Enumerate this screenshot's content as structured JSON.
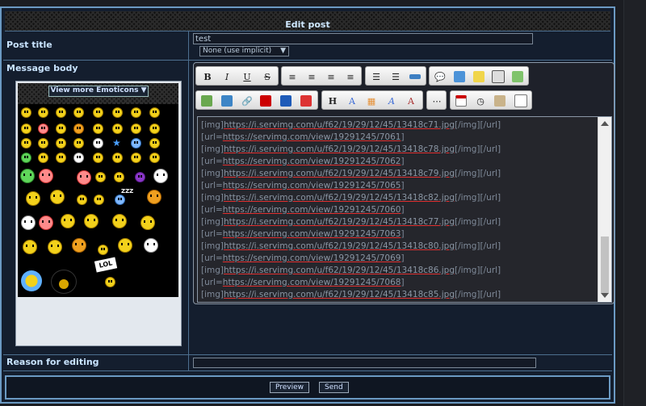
{
  "header": {
    "title": "Edit post"
  },
  "post_title": {
    "label": "Post title",
    "value": "test",
    "language_select": "None (use implicit)"
  },
  "message_body": {
    "label": "Message body",
    "emoticons": {
      "view_more_label": "View more Emoticons",
      "lol_sign": "LOL"
    },
    "toolbar": {
      "bold": "B",
      "italic": "I",
      "underline": "U",
      "strike": "S",
      "header": "H"
    },
    "lines": [
      {
        "t1": "[img]",
        "u": "https://i.servimg.com/u/f62/19/29/12/45/13418c71.jpg",
        "t2": "[/img][/url]"
      },
      {
        "t1": "[url=",
        "u": "https://servimg.com/view/19291245/7061",
        "t2": "]"
      },
      {
        "t1": "[img]",
        "u": "https://i.servimg.com/u/f62/19/29/12/45/13418c78.jpg",
        "t2": "[/img][/url]"
      },
      {
        "t1": "[url=",
        "u": "https://servimg.com/view/19291245/7062",
        "t2": "]"
      },
      {
        "t1": "[img]",
        "u": "https://i.servimg.com/u/f62/19/29/12/45/13418c79.jpg",
        "t2": "[/img][/url]"
      },
      {
        "t1": "[url=",
        "u": "https://servimg.com/view/19291245/7065",
        "t2": "]"
      },
      {
        "t1": "[img]",
        "u": "https://i.servimg.com/u/f62/19/29/12/45/13418c82.jpg",
        "t2": "[/img][/url]"
      },
      {
        "t1": "[url=",
        "u": "https://servimg.com/view/19291245/7060",
        "t2": "]"
      },
      {
        "t1": "[img]",
        "u": "https://i.servimg.com/u/f62/19/29/12/45/13418c77.jpg",
        "t2": "[/img][/url]"
      },
      {
        "t1": "[url=",
        "u": "https://servimg.com/view/19291245/7063",
        "t2": "]"
      },
      {
        "t1": "[img]",
        "u": "https://i.servimg.com/u/f62/19/29/12/45/13418c80.jpg",
        "t2": "[/img][/url]"
      },
      {
        "t1": "[url=",
        "u": "https://servimg.com/view/19291245/7069",
        "t2": "]"
      },
      {
        "t1": "[img]",
        "u": "https://i.servimg.com/u/f62/19/29/12/45/13418c86.jpg",
        "t2": "[/img][/url]"
      },
      {
        "t1": "[url=",
        "u": "https://servimg.com/view/19291245/7068",
        "t2": "]"
      },
      {
        "t1": "[img]",
        "u": "https://i.servimg.com/u/f62/19/29/12/45/13418c85.jpg",
        "t2": "[/img][/url]"
      }
    ]
  },
  "reason": {
    "label": "Reason for editing",
    "value": ""
  },
  "buttons": {
    "preview": "Preview",
    "send": "Send"
  },
  "colors": {
    "border": "#6b9ac3",
    "panel": "#141e2e",
    "link_underline": "#e03030"
  }
}
